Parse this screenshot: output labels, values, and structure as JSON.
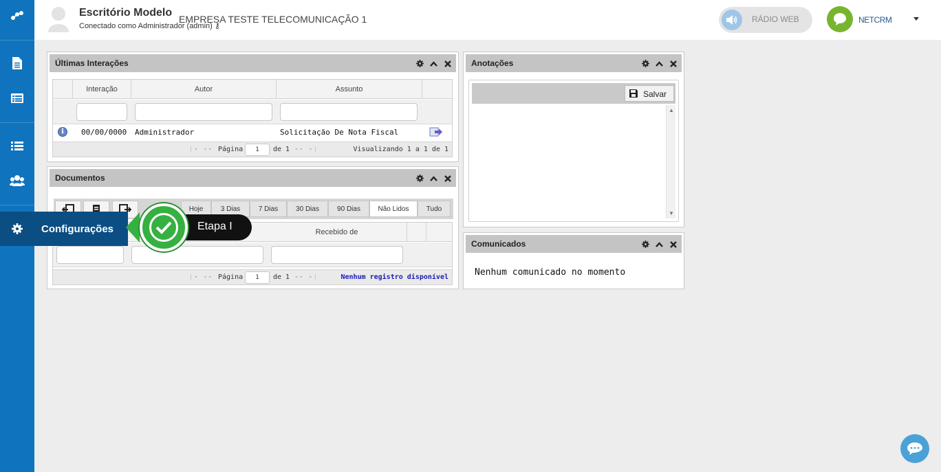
{
  "header": {
    "title": "Escritório Modelo",
    "subtitle": "Conectado como Administrador (admin)",
    "company": "EMPRESA TESTE TELECOMUNICAÇÃO 1",
    "radio_label": "RÁDIO WEB",
    "logo_text": "NETCRM"
  },
  "sidebar": {
    "items": [
      {
        "icon": "logo-icon"
      },
      {
        "icon": "document-icon"
      },
      {
        "icon": "card-list-icon"
      },
      {
        "icon": "list-icon"
      },
      {
        "icon": "users-icon"
      },
      {
        "icon": "gear-icon",
        "label": "Configurações"
      }
    ]
  },
  "tooltip": {
    "label": "Configurações",
    "step": "Etapa I"
  },
  "interactions": {
    "title": "Últimas Interações",
    "columns": [
      "Interação",
      "Autor",
      "Assunto"
    ],
    "rows": [
      {
        "date": "00/00/0000",
        "author": "Administrador",
        "subject": "Solicitação De Nota Fiscal"
      }
    ],
    "pager": {
      "page_label": "Página",
      "page": "1",
      "of": "de 1",
      "summary": "Visualizando 1 a 1 de 1"
    }
  },
  "documents": {
    "title": "Documentos",
    "tabs": [
      "Hoje",
      "3 Dias",
      "7 Dias",
      "30 Dias",
      "90 Dias",
      "Não Lidos",
      "Tudo"
    ],
    "active_tab": "Não Lidos",
    "columns": [
      "Recebido de"
    ],
    "pager": {
      "page_label": "Página",
      "page": "1",
      "of": "de 1",
      "summary": "Nenhum registro disponível"
    }
  },
  "notes": {
    "title": "Anotações",
    "save_label": "Salvar"
  },
  "announcements": {
    "title": "Comunicados",
    "empty": "Nenhum comunicado no momento"
  },
  "colors": {
    "sidebar": "#0f74bd",
    "tooltip_bg": "#0a4e84",
    "check": "#36b040",
    "panel_header": "#c4c4c4"
  }
}
